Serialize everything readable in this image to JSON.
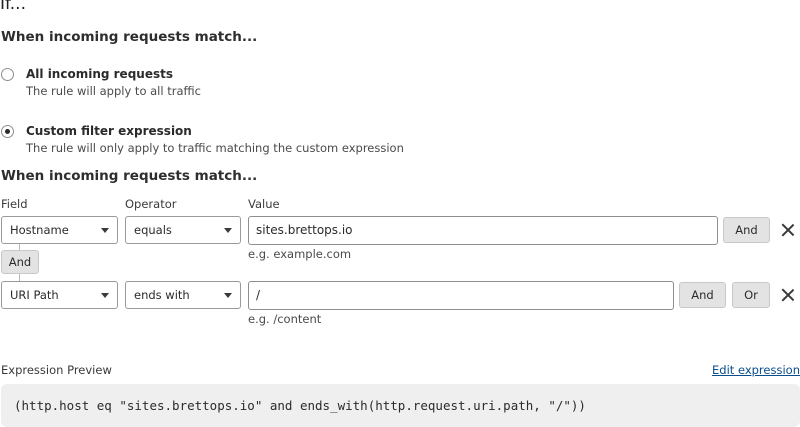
{
  "page": {
    "title": "If..."
  },
  "match_section": {
    "heading": "When incoming requests match..."
  },
  "options": [
    {
      "title": "All incoming requests",
      "description": "The rule will apply to all traffic",
      "checked": false
    },
    {
      "title": "Custom filter expression",
      "description": "The rule will only apply to traffic matching the custom expression",
      "checked": true
    }
  ],
  "builder": {
    "heading": "When incoming requests match...",
    "columns": {
      "field": "Field",
      "operator": "Operator",
      "value": "Value"
    },
    "rows": [
      {
        "field": "Hostname",
        "operator": "equals",
        "value": "sites.brettops.io",
        "hint": "e.g. example.com",
        "and_label": "And"
      },
      {
        "field": "URI Path",
        "operator": "ends with",
        "value": "/",
        "hint": "e.g. /content",
        "and_label": "And",
        "or_label": "Or"
      }
    ],
    "connector_label": "And"
  },
  "preview": {
    "label": "Expression Preview",
    "edit_link": "Edit expression",
    "expression": "(http.host eq \"sites.brettops.io\" and ends_with(http.request.uri.path, \"/\"))"
  }
}
